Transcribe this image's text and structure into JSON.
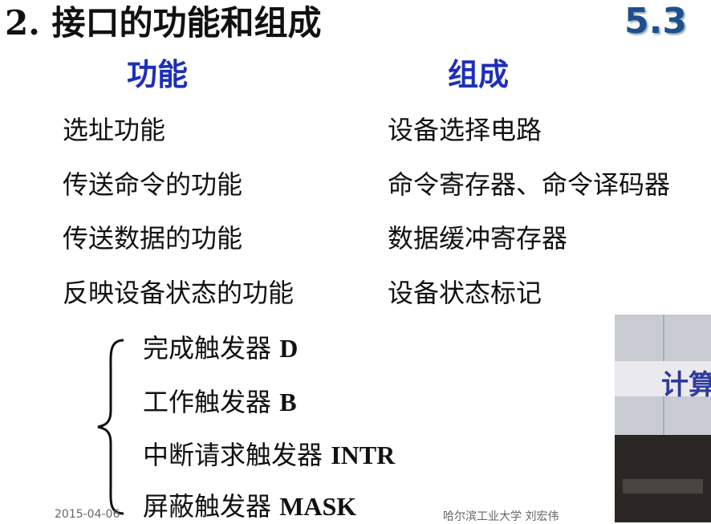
{
  "title": "2. 接口的功能和组成",
  "section_number": "5.3",
  "columns": {
    "function_header": "功能",
    "component_header": "组成"
  },
  "rows": [
    {
      "function": "选址功能",
      "component": "设备选择电路"
    },
    {
      "function": "传送命令的功能",
      "component": "命令寄存器、命令译码器"
    },
    {
      "function": "传送数据的功能",
      "component": "数据缓冲寄存器"
    },
    {
      "function": "反映设备状态的功能",
      "component": "设备状态标记"
    }
  ],
  "flip_flops": [
    {
      "name": "完成触发器",
      "symbol": "D"
    },
    {
      "name": "工作触发器",
      "symbol": "B"
    },
    {
      "name": "中断请求触发器",
      "symbol": "INTR"
    },
    {
      "name": "屏蔽触发器",
      "symbol": "MASK"
    }
  ],
  "footer": {
    "date": "2015-04-06",
    "institution": "哈尔滨工业大学  刘宏伟"
  },
  "video_overlay": {
    "banner_text": "计算"
  }
}
